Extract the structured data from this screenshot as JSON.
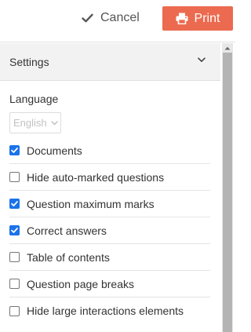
{
  "toolbar": {
    "cancel_label": "Cancel",
    "print_label": "Print",
    "print_color": "#ec6a4f"
  },
  "settings": {
    "title": "Settings",
    "language_label": "Language",
    "language_value": "English",
    "options": [
      {
        "label": "Documents",
        "checked": true
      },
      {
        "label": "Hide auto-marked questions",
        "checked": false
      },
      {
        "label": "Question maximum marks",
        "checked": true
      },
      {
        "label": "Correct answers",
        "checked": true
      },
      {
        "label": "Table of contents",
        "checked": false
      },
      {
        "label": "Question page breaks",
        "checked": false
      },
      {
        "label": "Hide large interactions elements",
        "checked": false
      }
    ]
  },
  "icons": {
    "cancel": "check-icon",
    "print": "printer-icon",
    "collapse": "chevron-down-icon",
    "select": "chevron-down-icon"
  }
}
